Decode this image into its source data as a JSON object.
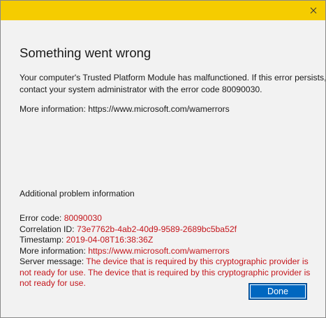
{
  "dialog": {
    "title": "Something went wrong",
    "description_line1": "Your computer's Trusted Platform Module has malfunctioned. If this error persists,",
    "description_line2": "contact your system administrator with the error code 80090030.",
    "more_info_label": "More information:",
    "more_info_url": "https://www.microsoft.com/wamerrors",
    "titlebar_color": "#f5cc00"
  },
  "additional": {
    "heading": "Additional problem information",
    "error_code_label": "Error code:",
    "error_code_value": "80090030",
    "correlation_label": "Correlation ID:",
    "correlation_value": "73e7762b-4ab2-40d9-9589-2689bc5ba52f",
    "timestamp_label": "Timestamp:",
    "timestamp_value": "2019-04-08T16:38:36Z",
    "more_info_label": "More information:",
    "more_info_url": "https://www.microsoft.com/wamerrors",
    "server_message_label": "Server message:",
    "server_message_value": "The device that is required by this cryptographic provider is not ready for use. The device that is required by this cryptographic provider is not ready for use.",
    "value_color": "#c4161c"
  },
  "buttons": {
    "done_label": "Done",
    "close_icon": "close-icon"
  }
}
